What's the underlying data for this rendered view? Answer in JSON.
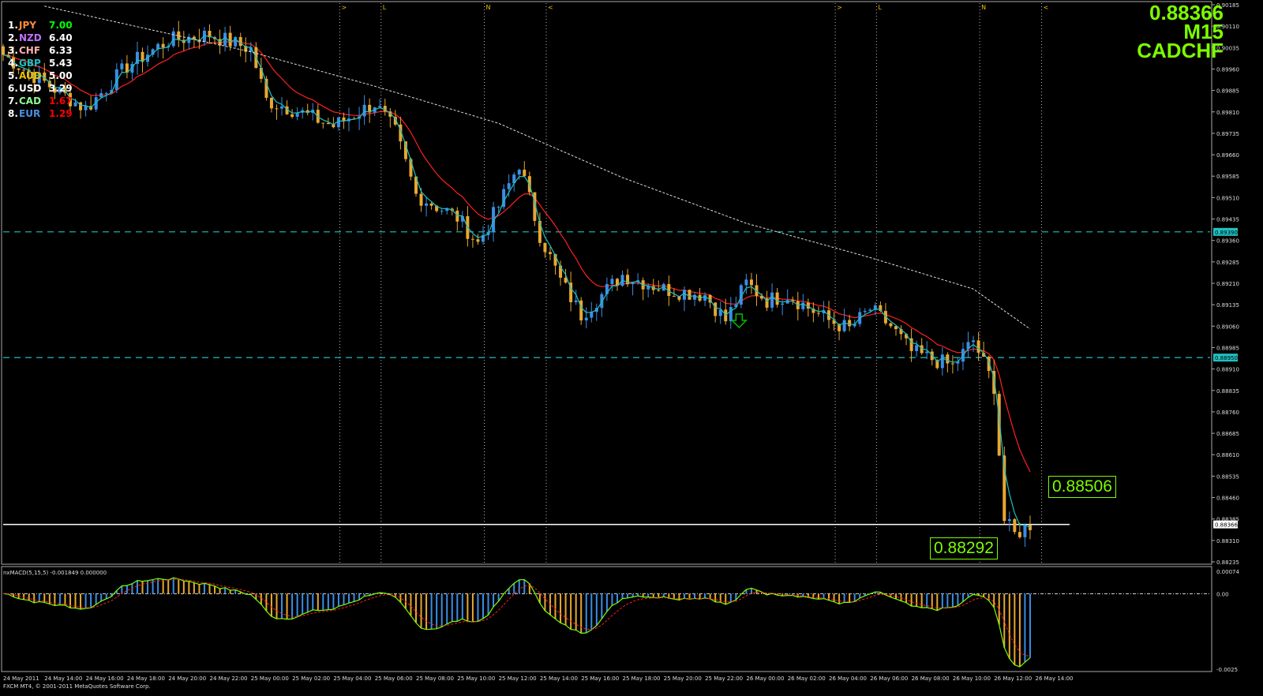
{
  "window": {
    "broker_copyright": "FXCM MT4, © 2001-2011 MetaQuotes Software Corp."
  },
  "quote": {
    "price": "0.88366",
    "timeframe": "M15",
    "symbol": "CADCHF",
    "color": "#7cfc00"
  },
  "price_boxes": {
    "upper": "0.88506",
    "lower": "0.88292"
  },
  "strength": [
    {
      "rank": "1.",
      "name": "JPY",
      "value": "7.00",
      "name_color": "#ff8c3a",
      "value_color": "#00ff00"
    },
    {
      "rank": "2.",
      "name": "NZD",
      "value": "6.40",
      "name_color": "#c070ff",
      "value_color": "#ffffff"
    },
    {
      "rank": "3.",
      "name": "CHF",
      "value": "6.33",
      "name_color": "#ffb0b0",
      "value_color": "#ffffff"
    },
    {
      "rank": "4.",
      "name": "GBP",
      "value": "5.43",
      "name_color": "#20c0c0",
      "value_color": "#ffffff"
    },
    {
      "rank": "5.",
      "name": "AUD",
      "value": "5.00",
      "name_color": "#e8c000",
      "value_color": "#ffffff"
    },
    {
      "rank": "6.",
      "name": "USD",
      "value": "3.29",
      "name_color": "#ffffff",
      "value_color": "#ffffff"
    },
    {
      "rank": "7.",
      "name": "CAD",
      "value": "1.67",
      "name_color": "#90ff90",
      "value_color": "#ff0000"
    },
    {
      "rank": "8.",
      "name": "EUR",
      "value": "1.29",
      "name_color": "#4a90e2",
      "value_color": "#ff0000"
    }
  ],
  "chart_data": {
    "type": "candlestick",
    "symbol": "CADCHF",
    "timeframe": "M15",
    "price_axis": {
      "ticks": [
        "0.90185",
        "0.90110",
        "0.90035",
        "0.89960",
        "0.89885",
        "0.89810",
        "0.89735",
        "0.89660",
        "0.89585",
        "0.89510",
        "0.89435",
        "0.89360",
        "0.89285",
        "0.89210",
        "0.89135",
        "0.89060",
        "0.88985",
        "0.88910",
        "0.88835",
        "0.88760",
        "0.88685",
        "0.88610",
        "0.88535",
        "0.88460",
        "0.88385",
        "0.88310",
        "0.88235"
      ],
      "ylim": [
        0.88235,
        0.90185
      ],
      "highlight_labels": [
        {
          "value": "0.89390",
          "color": "#20c0c0"
        },
        {
          "value": "0.88950",
          "color": "#20c0c0"
        },
        {
          "value": "0.88366",
          "color": "#ffffff"
        }
      ]
    },
    "time_axis": [
      "24 May 2011",
      "24 May 14:00",
      "24 May 16:00",
      "24 May 18:00",
      "24 May 20:00",
      "24 May 22:00",
      "25 May 00:00",
      "25 May 02:00",
      "25 May 04:00",
      "25 May 06:00",
      "25 May 08:00",
      "25 May 10:00",
      "25 May 12:00",
      "25 May 14:00",
      "25 May 16:00",
      "25 May 18:00",
      "25 May 20:00",
      "25 May 22:00",
      "26 May 00:00",
      "26 May 02:00",
      "26 May 04:00",
      "26 May 06:00",
      "26 May 08:00",
      "26 May 10:00",
      "26 May 12:00",
      "26 May 14:00"
    ],
    "horizontal_levels": [
      {
        "value": 0.8939,
        "style": "dashed",
        "color": "#20c0c0"
      },
      {
        "value": 0.8895,
        "style": "dashed",
        "color": "#20c0c0"
      },
      {
        "value": 0.88366,
        "style": "solid",
        "color": "#ffffff"
      }
    ],
    "session_markers": [
      {
        "label": ">",
        "time": "25 May 04:30"
      },
      {
        "label": "L",
        "time": "25 May 06:30"
      },
      {
        "label": "N",
        "time": "25 May 11:30"
      },
      {
        "label": "<",
        "time": "25 May 14:30"
      },
      {
        "label": ">",
        "time": "26 May 04:30"
      },
      {
        "label": "L",
        "time": "26 May 06:30"
      },
      {
        "label": "N",
        "time": "26 May 11:30"
      },
      {
        "label": "<",
        "time": "26 May 14:30"
      }
    ],
    "close_anchors": [
      {
        "time": "24 May 12:00",
        "close": 0.9001
      },
      {
        "time": "24 May 13:00",
        "close": 0.8996
      },
      {
        "time": "24 May 16:00",
        "close": 0.8982
      },
      {
        "time": "24 May 18:00",
        "close": 0.8997
      },
      {
        "time": "24 May 20:00",
        "close": 0.9006
      },
      {
        "time": "24 May 22:00",
        "close": 0.9008
      },
      {
        "time": "25 May 00:00",
        "close": 0.9003
      },
      {
        "time": "25 May 00:45",
        "close": 0.8985
      },
      {
        "time": "25 May 02:00",
        "close": 0.8982
      },
      {
        "time": "25 May 04:00",
        "close": 0.8976
      },
      {
        "time": "25 May 06:00",
        "close": 0.8984
      },
      {
        "time": "25 May 07:00",
        "close": 0.8974
      },
      {
        "time": "25 May 08:00",
        "close": 0.8952
      },
      {
        "time": "25 May 10:00",
        "close": 0.8944
      },
      {
        "time": "25 May 11:00",
        "close": 0.8935
      },
      {
        "time": "25 May 12:00",
        "close": 0.8948
      },
      {
        "time": "25 May 13:00",
        "close": 0.8963
      },
      {
        "time": "25 May 14:00",
        "close": 0.8938
      },
      {
        "time": "25 May 15:00",
        "close": 0.8922
      },
      {
        "time": "25 May 16:00",
        "close": 0.891
      },
      {
        "time": "25 May 18:00",
        "close": 0.8924
      },
      {
        "time": "25 May 20:00",
        "close": 0.8919
      },
      {
        "time": "25 May 22:00",
        "close": 0.8917
      },
      {
        "time": "25 May 23:00",
        "close": 0.8908
      },
      {
        "time": "26 May 00:00",
        "close": 0.8921
      },
      {
        "time": "26 May 01:00",
        "close": 0.8915
      },
      {
        "time": "26 May 02:00",
        "close": 0.8917
      },
      {
        "time": "26 May 04:00",
        "close": 0.8908
      },
      {
        "time": "26 May 05:00",
        "close": 0.8905
      },
      {
        "time": "26 May 06:00",
        "close": 0.8912
      },
      {
        "time": "26 May 07:00",
        "close": 0.8906
      },
      {
        "time": "26 May 08:00",
        "close": 0.8897
      },
      {
        "time": "26 May 10:00",
        "close": 0.8892
      },
      {
        "time": "26 May 11:00",
        "close": 0.8901
      },
      {
        "time": "26 May 12:00",
        "close": 0.8885
      },
      {
        "time": "26 May 12:30",
        "close": 0.8838
      },
      {
        "time": "26 May 13:00",
        "close": 0.8833
      },
      {
        "time": "26 May 13:45",
        "close": 0.88366
      }
    ],
    "moving_averages": [
      {
        "color": "#ffffff",
        "style": "dotted",
        "values": [
          [
            "24 May 14:00",
            0.9018
          ],
          [
            "25 May 00:00",
            0.9002
          ],
          [
            "25 May 06:00",
            0.899
          ],
          [
            "25 May 12:00",
            0.8977
          ],
          [
            "25 May 18:00",
            0.8958
          ],
          [
            "26 May 00:00",
            0.8942
          ],
          [
            "26 May 06:00",
            0.893
          ],
          [
            "26 May 11:00",
            0.8919
          ],
          [
            "26 May 13:45",
            0.8905
          ]
        ]
      },
      {
        "color": "#ff2020",
        "style": "solid",
        "period": "slow"
      },
      {
        "color": "#20c0c0",
        "style": "solid",
        "period": "fast"
      }
    ],
    "signal_arrow": {
      "time": "25 May 23:30",
      "direction": "down",
      "color": "#00c000"
    },
    "macd_panel": {
      "label": "nxMACD(5,15,5) -0.001849 0.000000",
      "axis_ticks": [
        "0.00074",
        "0.00",
        "-0.0025"
      ],
      "ylim": [
        -0.0025,
        0.00074
      ],
      "zero_line": 0.0,
      "current": -0.001849
    }
  }
}
